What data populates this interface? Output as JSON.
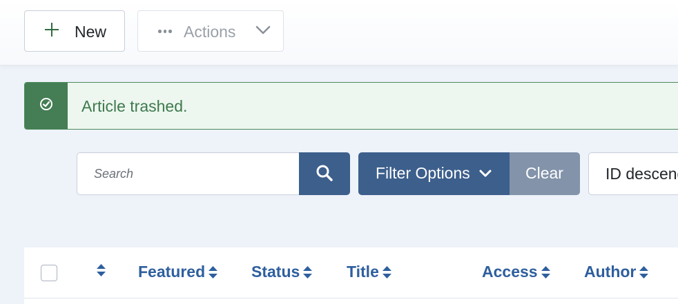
{
  "toolbar": {
    "new_label": "New",
    "actions_label": "Actions"
  },
  "alert": {
    "message": "Article trashed."
  },
  "filters": {
    "search_placeholder": "Search",
    "filter_options_label": "Filter Options",
    "clear_label": "Clear",
    "sort_label": "ID descending"
  },
  "table": {
    "columns": [
      "",
      "Featured",
      "Status",
      "Title",
      "Access",
      "Author"
    ]
  },
  "colors": {
    "primary": "#3d5f8c",
    "success": "#457d54",
    "link": "#2e5f9e"
  }
}
